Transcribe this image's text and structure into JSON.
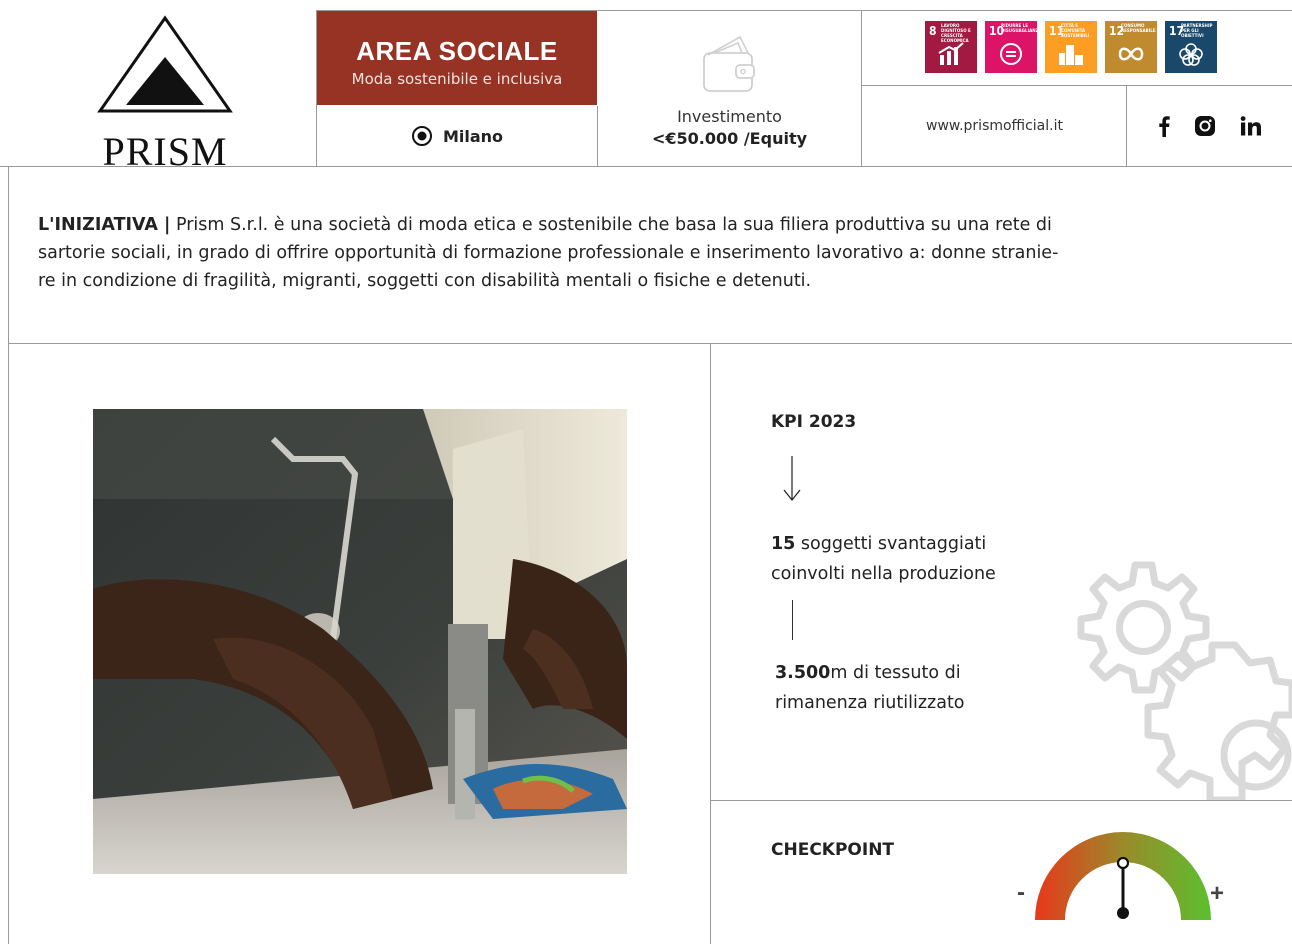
{
  "brand": {
    "logo_text": "PRISM"
  },
  "area": {
    "title": "AREA SOCIALE",
    "subtitle": "Moda sostenibile e inclusiva"
  },
  "location": {
    "city": "Milano"
  },
  "investment": {
    "label": "Investimento",
    "value": "<€50.000 /Equity"
  },
  "sdgs": [
    {
      "number": "8",
      "text": "Lavoro dignitoso e crescita economica",
      "color": "#a21942"
    },
    {
      "number": "10",
      "text": "Ridurre le disuguaglianze",
      "color": "#dd1367"
    },
    {
      "number": "11",
      "text": "Città e comunità sostenibili",
      "color": "#fd9d24"
    },
    {
      "number": "12",
      "text": "Consumo responsabile",
      "color": "#bf8b2e"
    },
    {
      "number": "17",
      "text": "Partnership per gli obiettivi",
      "color": "#19486a"
    }
  ],
  "contact": {
    "website": "www.prismofficial.it"
  },
  "social": {
    "icons": [
      "facebook-icon",
      "instagram-icon",
      "linkedin-icon"
    ]
  },
  "intro": {
    "lead": "L'INIZIATIVA |",
    "line1": " Prism S.r.l. è una società di moda etica e sostenibile che basa la sua filiera produttiva su una rete di",
    "line2": "sartorie sociali, in grado di offrire opportunità di formazione professionale e inserimento lavorativo a: donne stranie-",
    "line3": "re in condizione di fragilità, migranti, soggetti con disabilità mentali o fisiche e detenuti."
  },
  "kpi": {
    "title": "KPI 2023",
    "item1": {
      "value": "15",
      "text1": " soggetti svantaggiati",
      "text2": "coinvolti nella produzione"
    },
    "item2": {
      "value": "3.500",
      "text1": "m di tessuto di",
      "text2": "rimanenza riutilizzato"
    }
  },
  "checkpoint": {
    "title": "CHECKPOINT",
    "minus": "-",
    "plus": "+",
    "level": 0.5
  }
}
